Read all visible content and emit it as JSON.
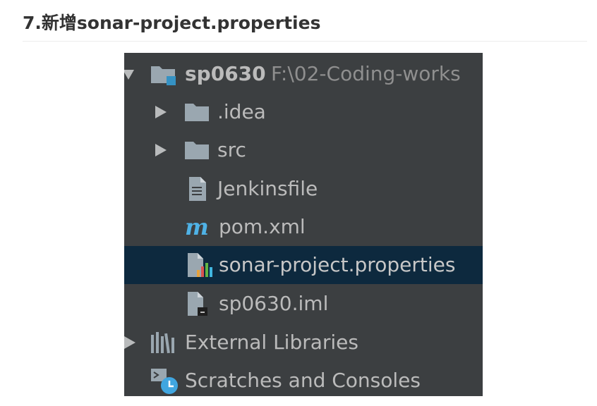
{
  "heading": "7.新增sonar-project.properties",
  "tree": {
    "root": {
      "name": "sp0630",
      "path": "F:\\02-Coding-works"
    },
    "items": [
      {
        "name": ".idea"
      },
      {
        "name": "src"
      },
      {
        "name": "Jenkinsfile"
      },
      {
        "name": "pom.xml"
      },
      {
        "name": "sonar-project.properties"
      },
      {
        "name": "sp0630.iml"
      }
    ],
    "external_libraries": "External Libraries",
    "scratches": "Scratches and Consoles"
  },
  "colors": {
    "panel_bg": "#3c3f41",
    "selected_row_bg": "#0d293e",
    "text": "#bbbbbb",
    "path_text": "#8f8f8f",
    "maven_blue": "#4fb2e6"
  }
}
